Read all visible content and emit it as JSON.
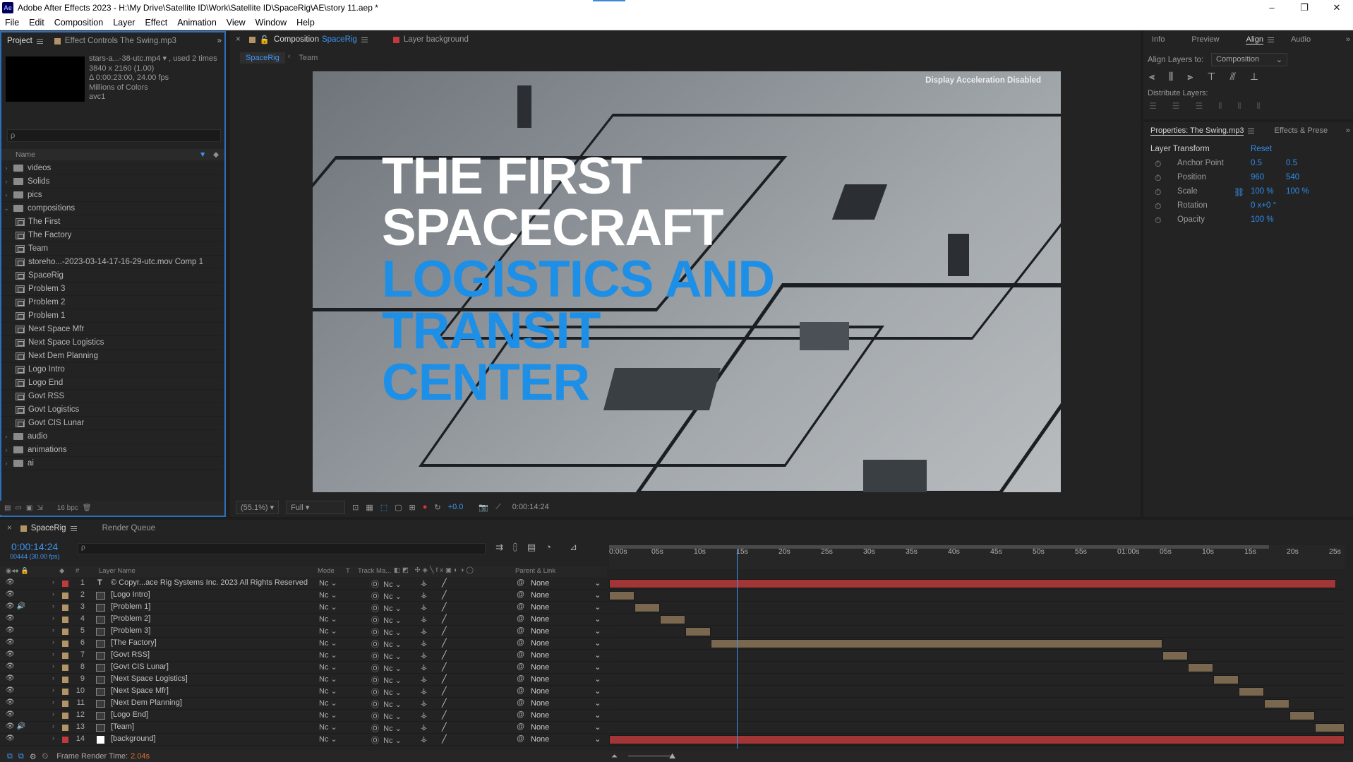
{
  "window": {
    "title": "Adobe After Effects 2023 - H:\\My Drive\\Satellite ID\\Work\\Satellite ID\\SpaceRig\\AE\\story 11.aep *",
    "logo": "Ae"
  },
  "menu": [
    "File",
    "Edit",
    "Composition",
    "Layer",
    "Effect",
    "Animation",
    "View",
    "Window",
    "Help"
  ],
  "project": {
    "tabs": [
      {
        "label": "Project"
      },
      {
        "label": "Effect Controls The Swing.mp3"
      }
    ],
    "info": [
      "stars-a...-38-utc.mp4 ▾ , used 2 times",
      "3840 x 2160 (1.00)",
      "Δ 0:00:23:00, 24.00 fps",
      "Millions of Colors",
      "avc1"
    ],
    "search_placeholder": "ρ",
    "column": "Name",
    "items": [
      {
        "type": "folder",
        "label": "videos"
      },
      {
        "type": "folder",
        "label": "Solids"
      },
      {
        "type": "folder",
        "label": "pics"
      },
      {
        "type": "folder",
        "label": "compositions",
        "open": true
      },
      {
        "type": "comp",
        "label": "The First"
      },
      {
        "type": "comp",
        "label": "The Factory"
      },
      {
        "type": "comp",
        "label": "Team"
      },
      {
        "type": "comp",
        "label": "storeho...-2023-03-14-17-16-29-utc.mov Comp 1"
      },
      {
        "type": "comp",
        "label": "SpaceRig"
      },
      {
        "type": "comp",
        "label": "Problem 3"
      },
      {
        "type": "comp",
        "label": "Problem 2"
      },
      {
        "type": "comp",
        "label": "Problem 1"
      },
      {
        "type": "comp",
        "label": "Next Space Mfr"
      },
      {
        "type": "comp",
        "label": "Next Space Logistics"
      },
      {
        "type": "comp",
        "label": "Next Dem Planning"
      },
      {
        "type": "comp",
        "label": "Logo Intro"
      },
      {
        "type": "comp",
        "label": "Logo End"
      },
      {
        "type": "comp",
        "label": "Govt RSS"
      },
      {
        "type": "comp",
        "label": "Govt Logistics"
      },
      {
        "type": "comp",
        "label": "Govt CIS Lunar"
      },
      {
        "type": "folder",
        "label": "audio"
      },
      {
        "type": "folder",
        "label": "animations"
      },
      {
        "type": "folder",
        "label": "ai"
      }
    ],
    "bpc": "16 bpc"
  },
  "comp": {
    "tab_prefix": "Composition",
    "tab_name": "SpaceRig",
    "layer_tab": "Layer  background",
    "sub_tabs": [
      "SpaceRig",
      "Team"
    ],
    "display_accel": "Display Acceleration Disabled",
    "headline_white": [
      "THE FIRST",
      "SPACECRAFT"
    ],
    "headline_blue": [
      "LOGISTICS AND",
      "TRANSIT",
      "CENTER"
    ],
    "zoom": "(55.1%)",
    "resolution": "Full",
    "exposure": "+0.0",
    "timecode": "0:00:14:24"
  },
  "right": {
    "tabs": [
      "Info",
      "Preview",
      "Align",
      "Audio"
    ],
    "align_to_label": "Align Layers to:",
    "align_to_value": "Composition",
    "distribute_label": "Distribute Layers:",
    "props_tab": "Properties: The Swing.mp3",
    "effects_tab": "Effects & Prese",
    "layer_transform": "Layer Transform",
    "reset": "Reset",
    "props": [
      {
        "name": "Anchor Point",
        "v1": "0.5",
        "v2": "0.5"
      },
      {
        "name": "Position",
        "v1": "960",
        "v2": "540"
      },
      {
        "name": "Scale",
        "v1": "100 %",
        "v2": "100 %"
      },
      {
        "name": "Rotation",
        "v1": "0 x+0 °",
        "v2": ""
      },
      {
        "name": "Opacity",
        "v1": "100 %",
        "v2": ""
      }
    ]
  },
  "timeline": {
    "tabs": [
      "SpaceRig",
      "Render Queue"
    ],
    "time": "0:00:14:24",
    "frames": "00444 (30.00 fps)",
    "headers": {
      "layer": "Layer Name",
      "mode": "Mode",
      "t": "T",
      "track": "Track Ma...",
      "parent": "Parent & Link"
    },
    "ticks": [
      "0:00s",
      "05s",
      "10s",
      "15s",
      "20s",
      "25s",
      "30s",
      "35s",
      "40s",
      "45s",
      "50s",
      "55s",
      "01:00s",
      "05s",
      "10s",
      "15s",
      "20s",
      "25s"
    ],
    "layers": [
      {
        "num": "1",
        "name": "© Copyr...ace Rig Systems Inc. 2023 All Rights Reserved",
        "color": "#c0393c",
        "text": true
      },
      {
        "num": "2",
        "name": "[Logo Intro]",
        "color": "#b39467"
      },
      {
        "num": "3",
        "name": "[Problem 1]",
        "color": "#b39467",
        "audio": true
      },
      {
        "num": "4",
        "name": "[Problem 2]",
        "color": "#b39467"
      },
      {
        "num": "5",
        "name": "[Problem 3]",
        "color": "#b39467"
      },
      {
        "num": "6",
        "name": "[The Factory]",
        "color": "#b39467"
      },
      {
        "num": "7",
        "name": "[Govt RSS]",
        "color": "#b39467"
      },
      {
        "num": "8",
        "name": "[Govt CIS Lunar]",
        "color": "#b39467"
      },
      {
        "num": "9",
        "name": "[Next Space Logistics]",
        "color": "#b39467"
      },
      {
        "num": "10",
        "name": "[Next Space Mfr]",
        "color": "#b39467"
      },
      {
        "num": "11",
        "name": "[Next Dem Planning]",
        "color": "#b39467"
      },
      {
        "num": "12",
        "name": "[Logo End]",
        "color": "#b39467"
      },
      {
        "num": "13",
        "name": "[Team]",
        "color": "#b39467",
        "audio": true
      },
      {
        "num": "14",
        "name": "[background]",
        "color": "#c0393c",
        "solid": true
      }
    ],
    "mode_value": "Nc",
    "parent_value": "None",
    "frame_render_label": "Frame Render Time:",
    "frame_render_value": "2.04s"
  }
}
